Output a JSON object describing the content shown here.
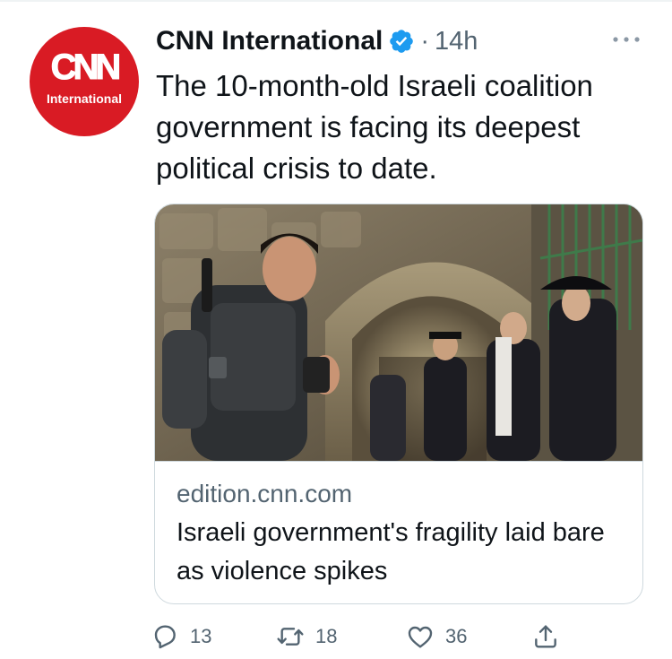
{
  "tweet": {
    "author": {
      "display_name": "CNN International",
      "avatar_logo": "CNN",
      "avatar_subtitle": "International",
      "verified_icon": "verified-badge-icon",
      "separator": "·",
      "time": "14h"
    },
    "more_icon": "more-horizontal-icon",
    "text": "The 10-month-old Israeli coalition government is facing its deepest political crisis to date.",
    "card": {
      "image_icon": "news-photo",
      "domain": "edition.cnn.com",
      "headline": "Israeli government's fragility laid bare as violence spikes"
    },
    "actions": {
      "reply": {
        "icon": "reply-icon",
        "count": "13"
      },
      "retweet": {
        "icon": "retweet-icon",
        "count": "18"
      },
      "like": {
        "icon": "like-icon",
        "count": "36"
      },
      "share": {
        "icon": "share-icon"
      }
    }
  },
  "colors": {
    "brand_red": "#d91b24",
    "verified_blue": "#1d9bf0",
    "secondary_text": "#536471",
    "border": "#cfd9de"
  }
}
